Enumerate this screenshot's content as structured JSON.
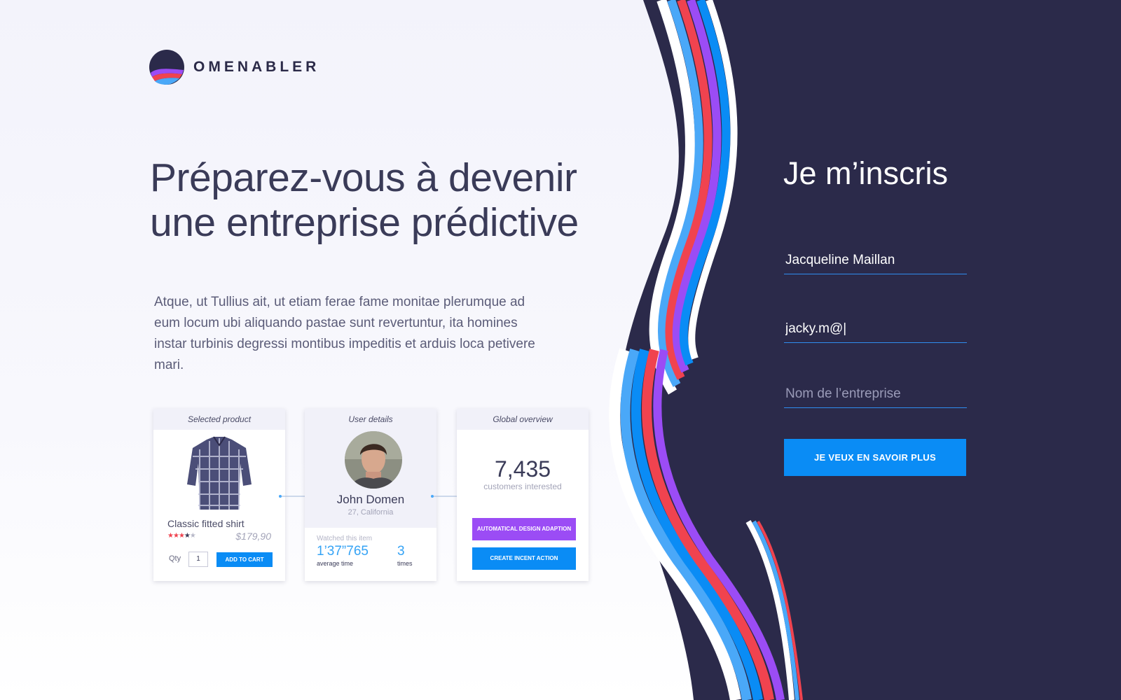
{
  "brand": {
    "name": "OMENABLER"
  },
  "hero": {
    "title_line1": "Préparez-vous à devenir",
    "title_line2": "une entreprise prédictive",
    "description": "Atque, ut Tullius ait, ut etiam ferae fame monitae plerumque ad eum locum ubi aliquando pastae sunt revertuntur, ita homines instar turbinis degressi montibus impeditis et arduis loca petivere mari."
  },
  "cards": {
    "product": {
      "header": "Selected product",
      "name": "Classic fitted shirt",
      "rating": "4 of 5",
      "price": "$179,90",
      "qty_label": "Qty",
      "qty_value": "1",
      "add_to_cart": "ADD TO CART"
    },
    "user": {
      "header": "User details",
      "name": "John Domen",
      "location": "27, California",
      "watched_label": "Watched this item",
      "avg_time": "1’37”765",
      "avg_time_label": "average time",
      "times": "3",
      "times_label": "times"
    },
    "global": {
      "header": "Global overview",
      "count": "7,435",
      "count_label": "customers interested",
      "btn_design": "AUTOMATICAL DESIGN ADAPTION",
      "btn_incent": "CREATE INCENT ACTION"
    }
  },
  "form": {
    "title": "Je m’inscris",
    "name_value": "Jacqueline Maillan",
    "email_value": "jacky.m@|",
    "company_placeholder": "Nom de l’entreprise",
    "submit_label": "JE VEUX EN SAVOIR PLUS"
  },
  "colors": {
    "dark_panel": "#2b2a4a",
    "accent_blue": "#0a8cf5",
    "accent_purple": "#9b4cf5",
    "accent_red": "#f0434f",
    "light_blue": "#4aa8f8"
  }
}
